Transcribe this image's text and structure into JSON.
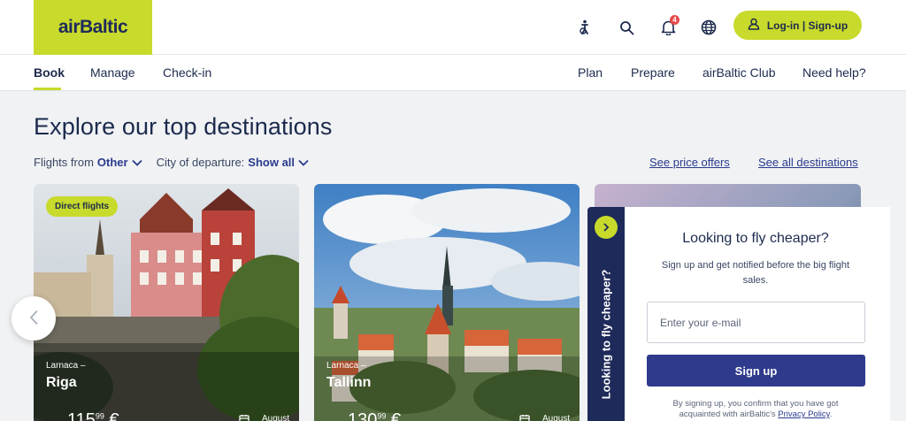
{
  "header": {
    "logo_text": "airBaltic",
    "notification_count": "4",
    "login_label": "Log-in | Sign-up",
    "icons": [
      "accessibility-icon",
      "search-icon",
      "bell-icon",
      "globe-icon",
      "user-icon"
    ]
  },
  "nav": {
    "left": [
      "Book",
      "Manage",
      "Check-in"
    ],
    "right": [
      "Plan",
      "Prepare",
      "airBaltic Club",
      "Need help?"
    ],
    "active": "Book"
  },
  "main": {
    "title": "Explore our top destinations",
    "flights_from_label": "Flights from",
    "flights_from_value": "Other",
    "city_label": "City of departure:",
    "city_value": "Show all",
    "price_offers_link": "See price offers",
    "all_destinations_link": "See all destinations"
  },
  "cards": [
    {
      "tag": "Direct flights",
      "from": "Larnaca –",
      "city": "Riga",
      "price_main": "115",
      "price_cents": "99",
      "currency": "€",
      "date": "August"
    },
    {
      "tag": "",
      "from": "Larnaca –",
      "city": "Tallinn",
      "price_main": "130",
      "price_cents": "99",
      "currency": "€",
      "date": "August"
    }
  ],
  "signup": {
    "tab_label": "Looking to fly cheaper?",
    "title": "Looking to fly cheaper?",
    "subtitle": "Sign up and get notified before the big flight sales.",
    "email_placeholder": "Enter your e-mail",
    "button": "Sign up",
    "consent_text": "By signing up, you confirm that you have got acquainted with airBaltic's",
    "privacy_link": "Privacy Policy",
    "consent_end": "."
  },
  "colors": {
    "brand_lime": "#c8da2b",
    "brand_navy": "#1e2a5a",
    "button_blue": "#2e3a8c"
  }
}
